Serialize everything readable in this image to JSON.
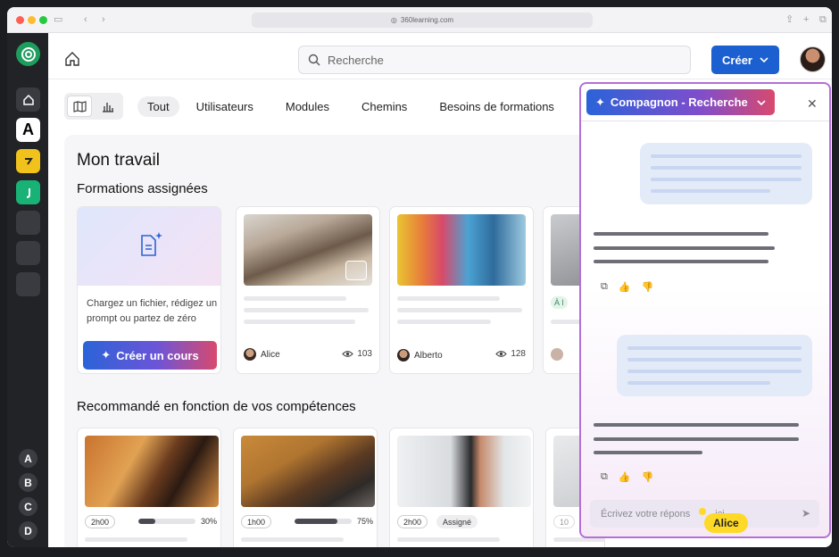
{
  "browser": {
    "url": "360learning.com"
  },
  "rail": {
    "letters": [
      "A",
      "B",
      "C",
      "D"
    ],
    "app_a": "A"
  },
  "topbar": {
    "search_placeholder": "Recherche",
    "create_label": "Créer"
  },
  "filters": [
    "Tout",
    "Utilisateurs",
    "Modules",
    "Chemins",
    "Besoins de formations"
  ],
  "work": {
    "title": "Mon travail",
    "assigned_title": "Formations assignées",
    "upload_text": "Chargez un fichier, rédigez un prompt ou partez de zéro",
    "create_course_label": "Créer un cours",
    "cards": [
      {
        "author": "Alice",
        "views": "103"
      },
      {
        "author": "Alberto",
        "views": "128"
      }
    ],
    "partial_badge": "À l"
  },
  "recommended": {
    "title": "Recommandé en fonction de vos compétences",
    "cards": [
      {
        "duration": "2h00",
        "progress": 0.3,
        "progress_label": "30%"
      },
      {
        "duration": "1h00",
        "progress": 0.75,
        "progress_label": "75%"
      },
      {
        "duration": "2h00",
        "badge": "Assigné"
      }
    ],
    "partial_duration": "10"
  },
  "panel": {
    "title": "Compagnon - Recherche",
    "input_placeholder": "Écrivez votre répons",
    "input_tail": "ici"
  },
  "cursor": {
    "label": "Alice"
  },
  "colors": {
    "primary": "#1b5fd0",
    "panel_border": "#b46fd8",
    "cursor": "#ffd928"
  }
}
